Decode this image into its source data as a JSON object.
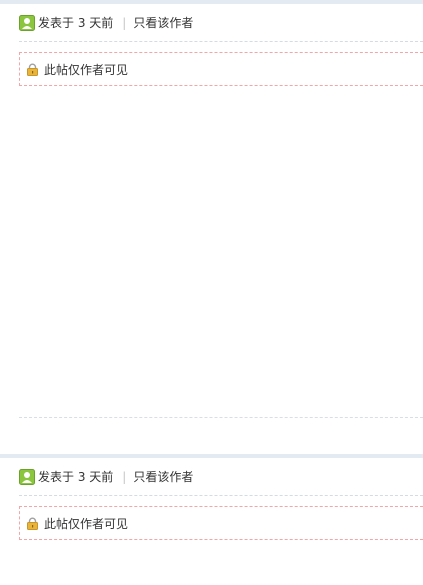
{
  "posts": [
    {
      "posted": "发表于 3 天前",
      "divider": "|",
      "only_author": "只看该作者",
      "locked_notice": "此帖仅作者可见"
    },
    {
      "posted": "发表于 3 天前",
      "divider": "|",
      "only_author": "只看该作者",
      "locked_notice": "此帖仅作者可见"
    }
  ],
  "icons": {
    "avatar": "user-avatar-icon",
    "lock": "lock-icon"
  },
  "colors": {
    "topbar": "#e3eaf1",
    "avatar_green": "#8cc63f",
    "lock_gold": "#e8b53a",
    "notice_border": "#f2a6a6"
  }
}
